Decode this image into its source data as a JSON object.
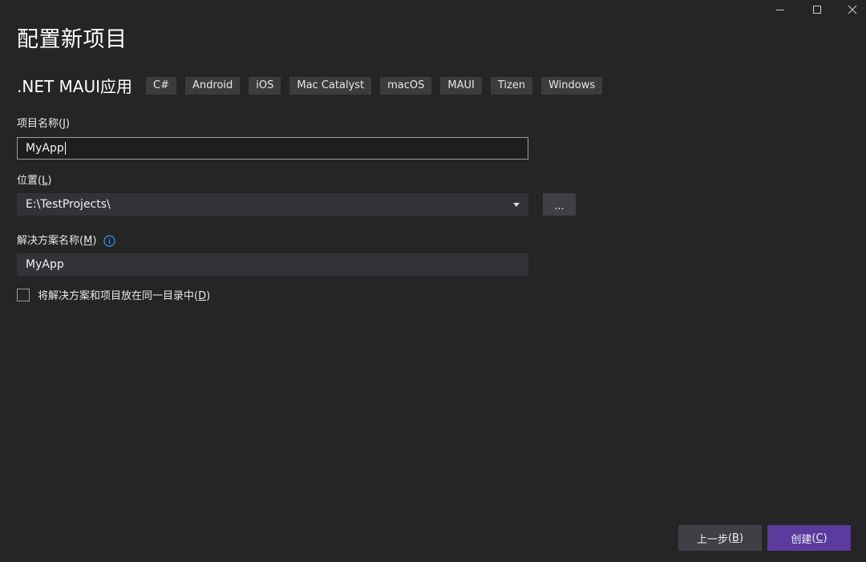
{
  "window": {
    "minimize_icon": "minimize-icon",
    "maximize_icon": "maximize-icon",
    "close_icon": "close-icon"
  },
  "page": {
    "title": "配置新项目",
    "template_name": ".NET MAUI应用",
    "tags": [
      "C#",
      "Android",
      "iOS",
      "Mac Catalyst",
      "macOS",
      "MAUI",
      "Tizen",
      "Windows"
    ]
  },
  "project_name": {
    "label": "项目名称",
    "mnemonic": "J",
    "value": "MyApp"
  },
  "location": {
    "label": "位置",
    "mnemonic": "L",
    "value": "E:\\TestProjects\\",
    "browse_label": "..."
  },
  "solution_name": {
    "label": "解决方案名称",
    "mnemonic": "M",
    "value": "MyApp",
    "info_icon": "info-icon"
  },
  "same_directory": {
    "label": "将解决方案和项目放在同一目录中",
    "mnemonic": "D",
    "checked": false
  },
  "footer": {
    "back_label": "上一步",
    "back_mnemonic": "B",
    "create_label": "创建",
    "create_mnemonic": "C"
  },
  "colors": {
    "background": "#252526",
    "accent": "#5b3b9e",
    "input_background": "#333337",
    "info_icon": "#3794ff"
  }
}
